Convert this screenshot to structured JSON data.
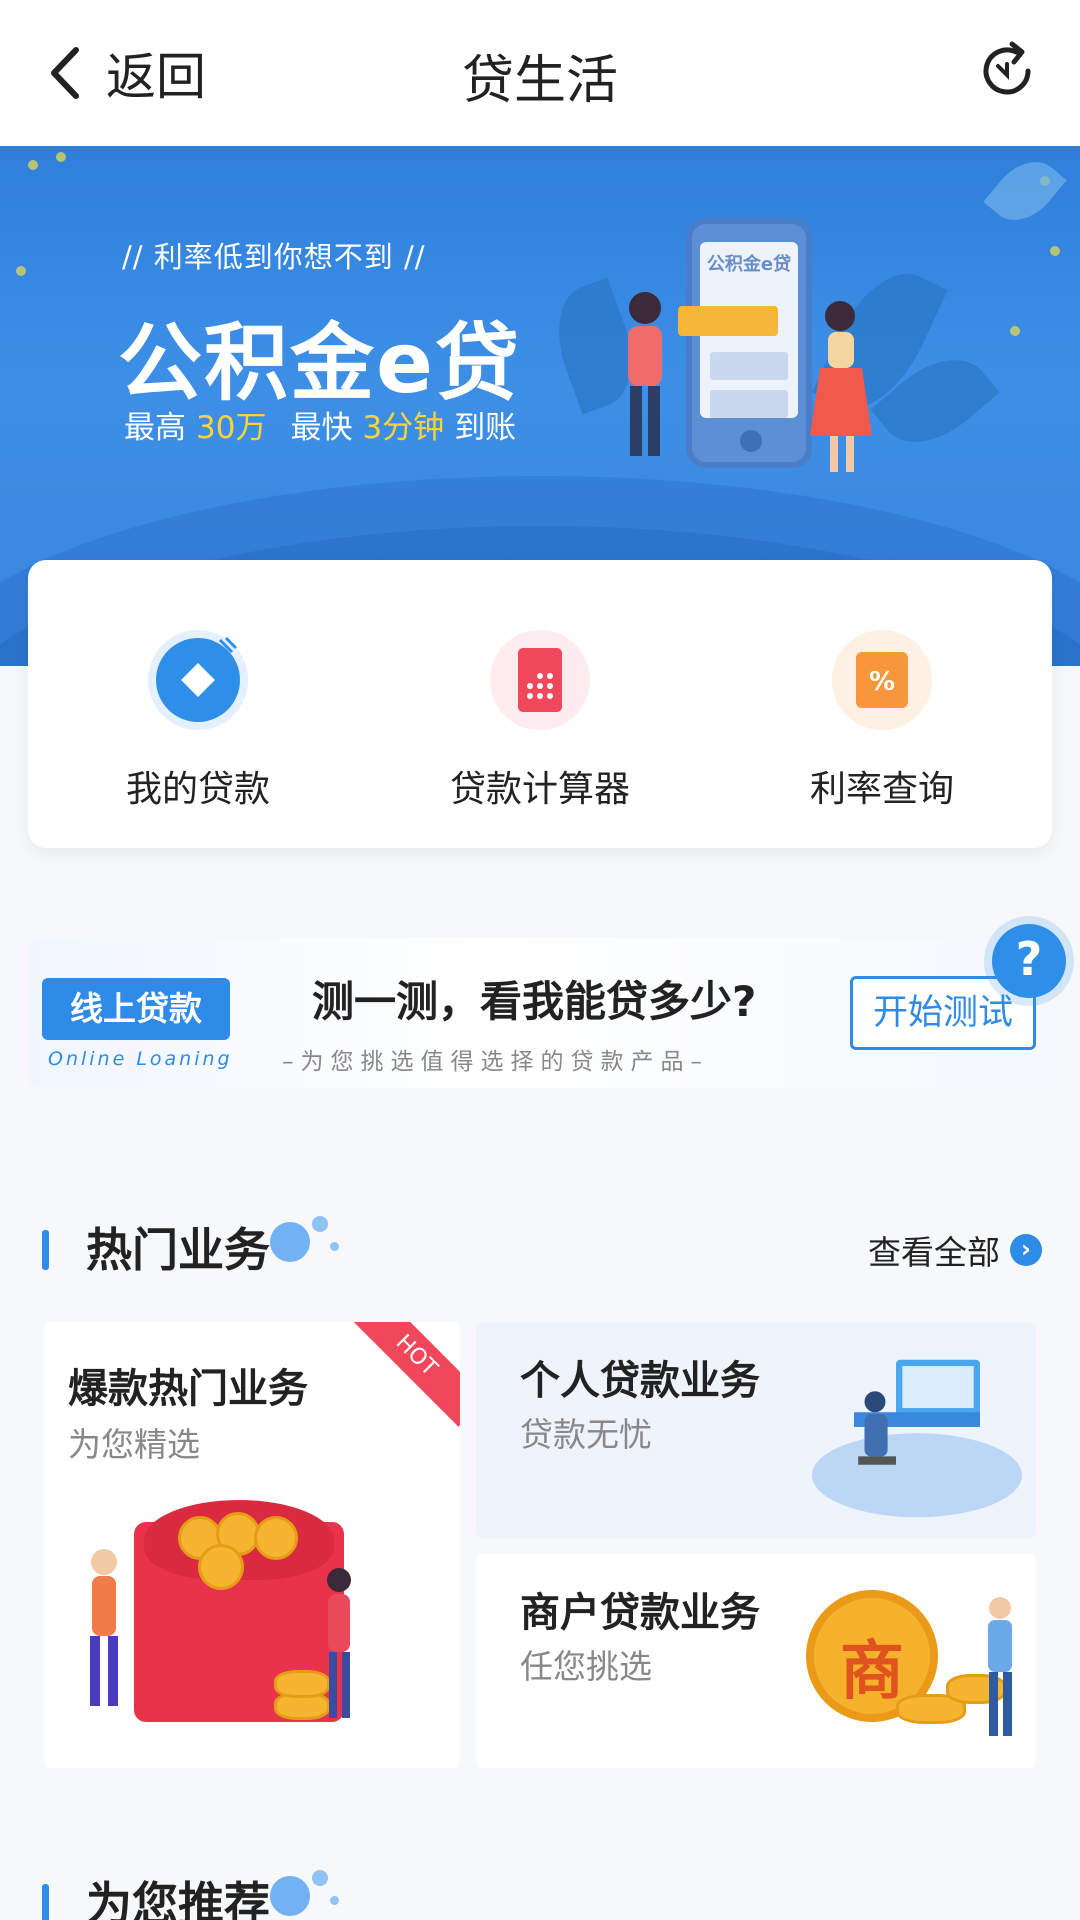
{
  "header": {
    "back_label": "返回",
    "title": "贷生活"
  },
  "banner": {
    "tagline": "// 利率低到你想不到 //",
    "product_name": "公积金e贷",
    "sub_prefix1": "最高",
    "sub_value1": "30万",
    "sub_prefix2": "最快",
    "sub_value2": "3分钟",
    "sub_suffix": "到账",
    "phone_title": "公积金e贷"
  },
  "quick_actions": [
    {
      "label": "我的贷款",
      "icon": "loan-icon",
      "color": "#2f8fe8"
    },
    {
      "label": "贷款计算器",
      "icon": "calculator-icon",
      "color": "#f0485a"
    },
    {
      "label": "利率查询",
      "icon": "percent-icon",
      "color": "#f7963a"
    }
  ],
  "online_loan": {
    "badge": "线上贷款",
    "badge_en": "Online Loaning",
    "question": "测一测，看我能贷多少?",
    "subtitle": "–为您挑选值得选择的贷款产品–",
    "start_button": "开始测试"
  },
  "hot_section": {
    "title": "热门业务",
    "more_label": "查看全部",
    "cards": [
      {
        "title": "爆款热门业务",
        "subtitle": "为您精选",
        "badge": "HOT"
      },
      {
        "title": "个人贷款业务",
        "subtitle": "贷款无忧"
      },
      {
        "title": "商户贷款业务",
        "subtitle": "任您挑选",
        "emblem": "商"
      }
    ]
  },
  "recommend_section": {
    "title": "为您推荐"
  },
  "colors": {
    "accent": "#2e8be8",
    "highlight": "#ffd23a",
    "hot": "#f0485a"
  }
}
